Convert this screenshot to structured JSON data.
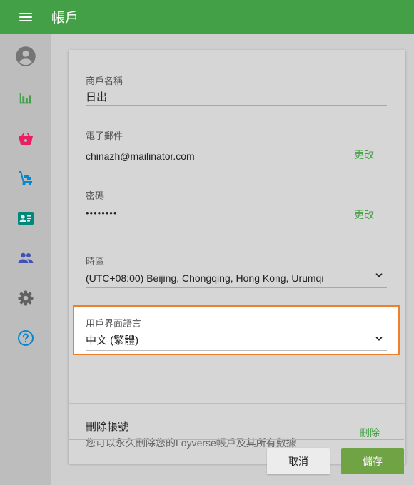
{
  "header": {
    "title": "帳戶",
    "menu_icon": "hamburger-menu-icon"
  },
  "sidebar": {
    "items": [
      {
        "name": "account",
        "icon": "account-circle-icon",
        "color": "#757575"
      },
      {
        "name": "reports",
        "icon": "bar-chart-icon",
        "color": "#43a047"
      },
      {
        "name": "items",
        "icon": "basket-icon",
        "color": "#e91e63"
      },
      {
        "name": "inventory",
        "icon": "hand-truck-icon",
        "color": "#0288d1"
      },
      {
        "name": "customers",
        "icon": "contact-card-icon",
        "color": "#00897b"
      },
      {
        "name": "employees",
        "icon": "people-icon",
        "color": "#3f51b5"
      },
      {
        "name": "settings",
        "icon": "gear-icon",
        "color": "#616161"
      },
      {
        "name": "help",
        "icon": "help-circle-icon",
        "color": "#0288d1"
      }
    ]
  },
  "form": {
    "business_name": {
      "label": "商戶名稱",
      "value": "日出"
    },
    "email": {
      "label": "電子郵件",
      "value": "chinazh@mailinator.com",
      "action": "更改"
    },
    "password": {
      "label": "密碼",
      "value": "••••••••",
      "action": "更改"
    },
    "timezone": {
      "label": "時區",
      "value": "(UTC+08:00) Beijing, Chongqing, Hong Kong, Urumqi"
    },
    "language": {
      "label": "用戶界面語言",
      "value": "中文 (繁體)"
    }
  },
  "delete_account": {
    "title": "刪除帳號",
    "description": "您可以永久刪除您的Loyverse帳戶及其所有數據",
    "action": "刪除"
  },
  "footer": {
    "cancel_label": "取消",
    "save_label": "儲存"
  },
  "colors": {
    "primary": "#43a047",
    "highlight_border": "#ef7f2a"
  }
}
